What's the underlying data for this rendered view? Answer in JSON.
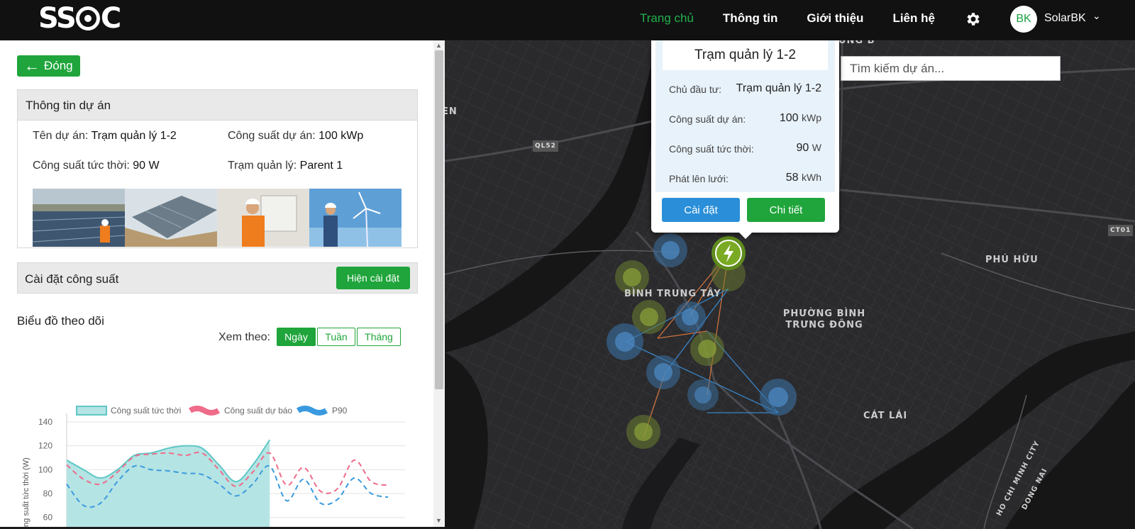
{
  "nav": {
    "logo_text": "SSOC",
    "links": [
      "Trang chủ",
      "Thông tin",
      "Giới thiệu",
      "Liên hệ"
    ],
    "avatar_initials": "BK",
    "user_name": "SolarBK"
  },
  "panel": {
    "close_label": "Đóng",
    "info_title": "Thông tin dự án",
    "project_name_label": "Tên dự án:",
    "project_name": "Trạm quản lý 1-2",
    "capacity_label": "Công suất dự án:",
    "capacity": "100 kWp",
    "instant_power_label": "Công suất tức thời:",
    "instant_power": "90 W",
    "station_label": "Trạm quản lý:",
    "station": "Parent 1",
    "power_settings_title": "Cài đặt công suất",
    "show_settings_label": "Hiện cài đặt",
    "chart_title": "Biểu đồ theo dõi",
    "view_by_label": "Xem theo:",
    "view_options": [
      "Ngày",
      "Tuần",
      "Tháng"
    ]
  },
  "map": {
    "search_placeholder": "Tìm kiếm dự án...",
    "labels": {
      "binh_trung_tay": "BÌNH TRUNG TÂY",
      "phuong_binh_trung_dong": "PHƯỜNG BÌNH TRƯNG ĐÔNG",
      "phu_huu": "PHÚ HỮU",
      "cat_lai": "CÁT LÁI",
      "hcmc": "HO CHI MINH CITY",
      "dong_nai": "DONG NAI",
      "ql52": "QL52",
      "ct01": "CT01",
      "en": "EN",
      "ung_b": "ÙNG B"
    },
    "popup": {
      "title": "Trạm quản lý 1-2",
      "owner_label": "Chủ đầu tư:",
      "owner": "Trạm quản lý 1-2",
      "capacity_label": "Công suất dự án:",
      "capacity_value": "100",
      "capacity_unit": "kWp",
      "instant_label": "Công suất tức thời:",
      "instant_value": "90",
      "instant_unit": "W",
      "grid_label": "Phát lên lưới:",
      "grid_value": "58",
      "grid_unit": "kWh",
      "settings_button": "Cài đặt",
      "details_button": "Chi tiết"
    }
  },
  "colors": {
    "brand_green": "#1fa53b",
    "nav_active": "#22b14c",
    "popup_blue": "#2a8fd8",
    "series_instant": "#5ec7c5",
    "series_forecast": "#ef6b8a",
    "series_p90": "#3a9ae0"
  },
  "chart_data": {
    "type": "line",
    "ylabel": "Công suất tức thời (W)",
    "ylim": [
      45,
      140
    ],
    "yticks": [
      140,
      120,
      100,
      80,
      60
    ],
    "x": [
      0,
      1,
      2,
      3,
      4,
      5,
      6,
      7,
      8,
      9,
      10,
      11,
      12,
      13,
      14,
      15,
      16,
      17,
      18,
      19,
      20
    ],
    "series": [
      {
        "name": "Công suất tức thời",
        "style": "area",
        "values": [
          108,
          100,
          93,
          100,
          112,
          114,
          118,
          120,
          118,
          104,
          90,
          104,
          125
        ]
      },
      {
        "name": "Công suất dự báo",
        "style": "dashed",
        "values": [
          104,
          92,
          88,
          98,
          111,
          113,
          114,
          112,
          114,
          100,
          86,
          98,
          114,
          87,
          102,
          82,
          84,
          108,
          90,
          87
        ]
      },
      {
        "name": "P90",
        "style": "dashed",
        "values": [
          88,
          70,
          72,
          90,
          103,
          100,
          99,
          97,
          96,
          88,
          78,
          88,
          103,
          74,
          92,
          72,
          75,
          93,
          80,
          77
        ]
      }
    ]
  }
}
